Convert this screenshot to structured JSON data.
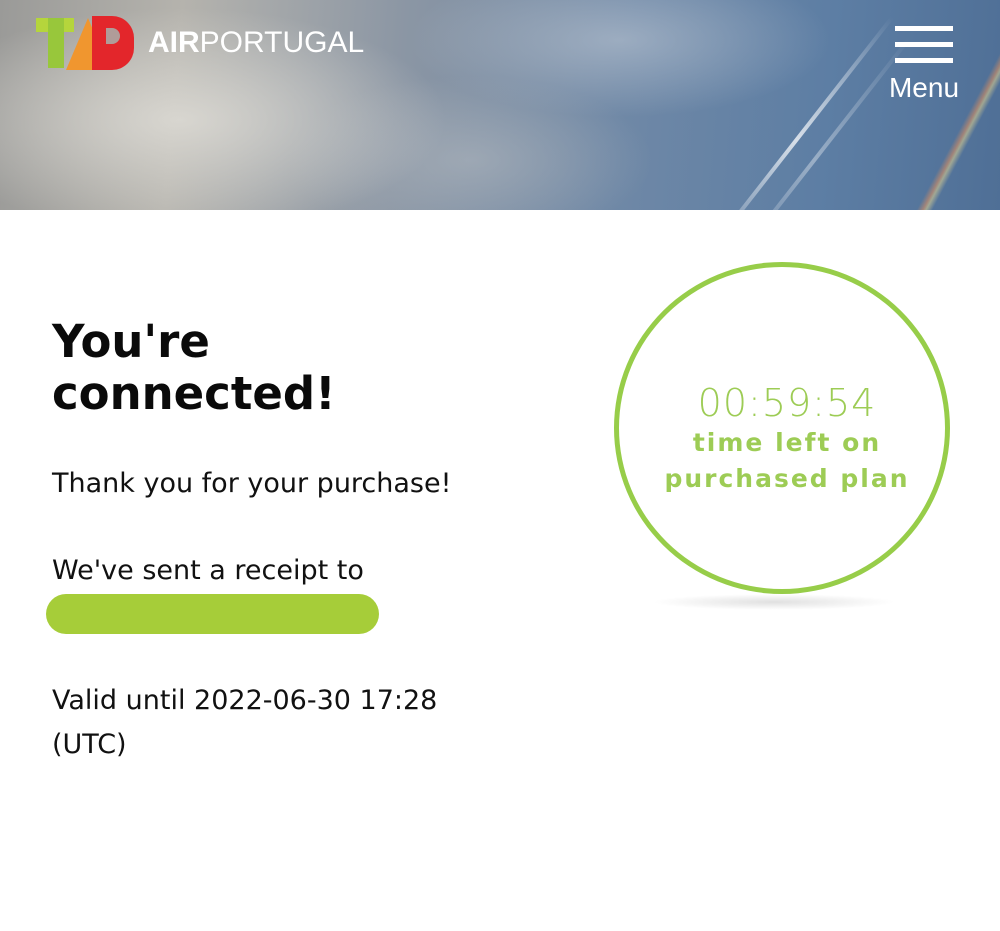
{
  "header": {
    "logo": {
      "mark": "TAP",
      "air": "AIR",
      "portugal": "PORTUGAL"
    },
    "menu_label": "Menu",
    "menu_icon": "hamburger-icon"
  },
  "main": {
    "title": "You're connected!",
    "thanks": "Thank you for your purchase!",
    "receipt_text": "We've sent a receipt to",
    "valid_until": "Valid until 2022-06-30 17:28 (UTC)"
  },
  "timer": {
    "value": "00:59:54",
    "label": "time left on purchased plan"
  },
  "colors": {
    "accent_green": "#9dcc55",
    "redaction_green": "#a6cd39",
    "text": "#111111"
  }
}
